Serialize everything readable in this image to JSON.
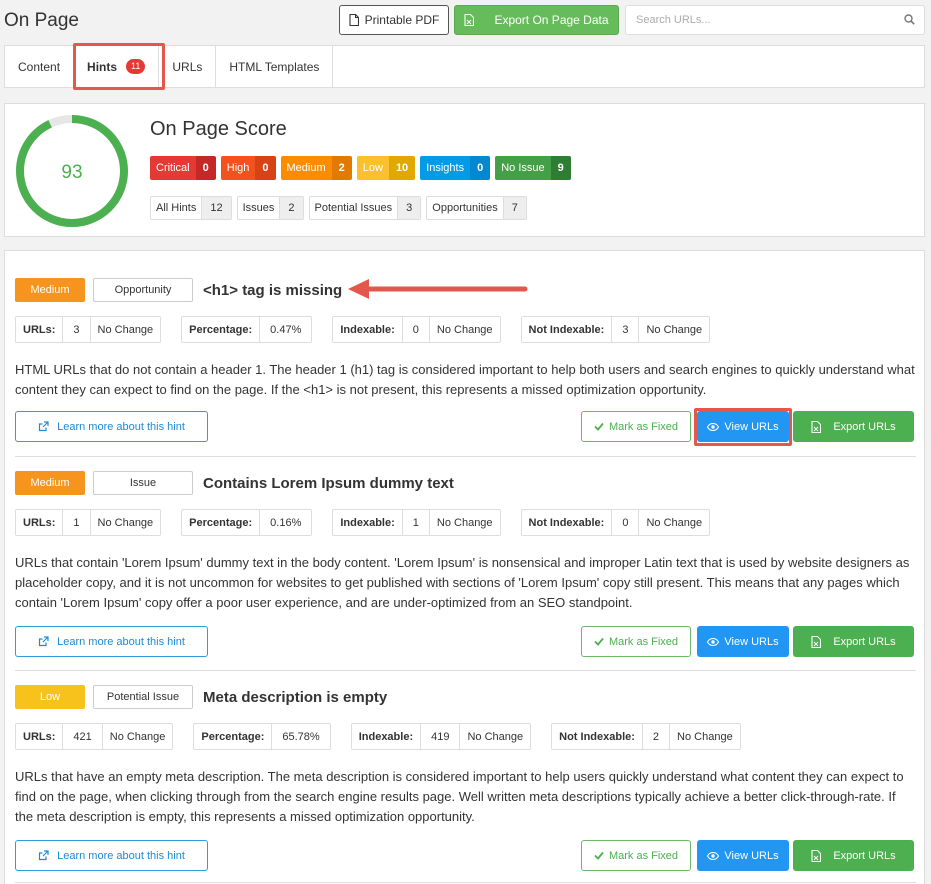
{
  "header": {
    "title": "On Page",
    "pdf_label": "Printable PDF",
    "export_label": "Export On Page Data",
    "search_placeholder": "Search URLs..."
  },
  "tabs": [
    {
      "label": "Content"
    },
    {
      "label": "Hints",
      "badge": "11"
    },
    {
      "label": "URLs"
    },
    {
      "label": "HTML Templates"
    }
  ],
  "score": {
    "title": "On Page Score",
    "value": "93",
    "fraction": 0.93,
    "severities": [
      {
        "label": "Critical",
        "count": "0",
        "color": "#e53935",
        "count_color": "#c62828"
      },
      {
        "label": "High",
        "count": "0",
        "color": "#f4511e",
        "count_color": "#d84315"
      },
      {
        "label": "Medium",
        "count": "2",
        "color": "#fb8c00",
        "count_color": "#e27a00"
      },
      {
        "label": "Low",
        "count": "10",
        "color": "#fbc02d",
        "count_color": "#e0a800"
      },
      {
        "label": "Insights",
        "count": "0",
        "color": "#039be5",
        "count_color": "#0288d1"
      },
      {
        "label": "No Issue",
        "count": "9",
        "color": "#43a047",
        "count_color": "#2e7d32"
      }
    ],
    "filters": [
      {
        "label": "All Hints",
        "count": "12"
      },
      {
        "label": "Issues",
        "count": "2"
      },
      {
        "label": "Potential Issues",
        "count": "3"
      },
      {
        "label": "Opportunities",
        "count": "7"
      }
    ]
  },
  "hints": [
    {
      "priority": "Medium",
      "type": "Opportunity",
      "title": "<h1> tag is missing",
      "stats": [
        {
          "label": "URLs:",
          "value": "3",
          "change": "No Change"
        },
        {
          "label": "Percentage:",
          "value": "0.47%"
        },
        {
          "label": "Indexable:",
          "value": "0",
          "change": "No Change"
        },
        {
          "label": "Not Indexable:",
          "value": "3",
          "change": "No Change"
        }
      ],
      "description": "HTML URLs that do not contain a header 1. The header 1 (h1) tag is considered important to help both users and search engines to quickly understand what content they can expect to find on the page. If the <h1> is not present, this represents a missed optimization opportunity."
    },
    {
      "priority": "Medium",
      "type": "Issue",
      "title": "Contains Lorem Ipsum dummy text",
      "stats": [
        {
          "label": "URLs:",
          "value": "1",
          "change": "No Change"
        },
        {
          "label": "Percentage:",
          "value": "0.16%"
        },
        {
          "label": "Indexable:",
          "value": "1",
          "change": "No Change"
        },
        {
          "label": "Not Indexable:",
          "value": "0",
          "change": "No Change"
        }
      ],
      "description": "URLs that contain 'Lorem Ipsum' dummy text in the body content. 'Lorem Ipsum' is nonsensical and improper Latin text that is used by website designers as placeholder copy, and it is not uncommon for websites to get published with sections of 'Lorem Ipsum' copy still present. This means that any pages which contain 'Lorem Ipsum' copy offer a poor user experience, and are under-optimized from an SEO standpoint."
    },
    {
      "priority": "Low",
      "type": "Potential Issue",
      "title": "Meta description is empty",
      "stats": [
        {
          "label": "URLs:",
          "value": "421",
          "change": "No Change"
        },
        {
          "label": "Percentage:",
          "value": "65.78%"
        },
        {
          "label": "Indexable:",
          "value": "419",
          "change": "No Change"
        },
        {
          "label": "Not Indexable:",
          "value": "2",
          "change": "No Change"
        }
      ],
      "description": "URLs that have an empty meta description. The meta description is considered important to help users quickly understand what content they can expect to find on the page, when clicking through from the search engine results page. Well written meta descriptions typically achieve a better click-through-rate. If the meta description is empty, this represents a missed optimization opportunity."
    }
  ],
  "actions": {
    "learn_more": "Learn more about this hint",
    "mark_fixed": "Mark as Fixed",
    "view_urls": "View URLs",
    "export_urls": "Export URLs"
  },
  "colors": {
    "accent_blue": "#2196f3",
    "green": "#4caf50",
    "highlight": "#e4574c"
  }
}
